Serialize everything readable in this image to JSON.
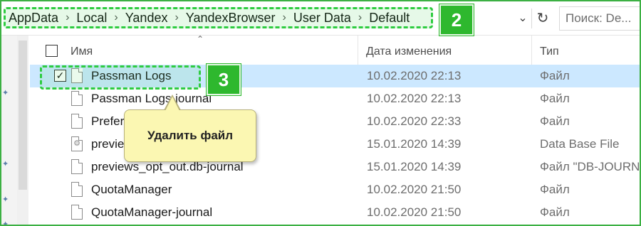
{
  "address_bar": {
    "breadcrumbs": [
      "AppData",
      "Local",
      "Yandex",
      "YandexBrowser",
      "User Data",
      "Default"
    ],
    "separator": "›",
    "dropdown_icon": "chevron-down-icon",
    "refresh_icon": "refresh-icon",
    "search_placeholder": "Поиск: De..."
  },
  "annotations": {
    "badge_address": "2",
    "badge_file": "3",
    "highlight_color": "#2ecc40",
    "tooltip_text": "Удалить файл"
  },
  "columns": {
    "name": "Имя",
    "date": "Дата изменения",
    "type": "Тип"
  },
  "files": [
    {
      "name": "Passman Logs",
      "date": "10.02.2020 22:13",
      "type": "Файл",
      "selected": true,
      "checked": true
    },
    {
      "name": "Passman Logs-journal",
      "date": "10.02.2020 22:13",
      "type": "Файл"
    },
    {
      "name": "Preferences",
      "date": "10.02.2020 22:33",
      "type": "Файл"
    },
    {
      "name": "previews_opt_out.db",
      "date": "15.01.2020 14:39",
      "type": "Data Base File"
    },
    {
      "name": "previews_opt_out.db-journal",
      "date": "15.01.2020 14:39",
      "type": "Файл \"DB-JOURNAL\""
    },
    {
      "name": "QuotaManager",
      "date": "10.02.2020 21:50",
      "type": "Файл"
    },
    {
      "name": "QuotaManager-journal",
      "date": "10.02.2020 21:50",
      "type": "Файл"
    }
  ],
  "colors": {
    "selection": "#cce8ff",
    "badge": "#2eb82e",
    "tooltip_bg": "#fbf7b2"
  }
}
